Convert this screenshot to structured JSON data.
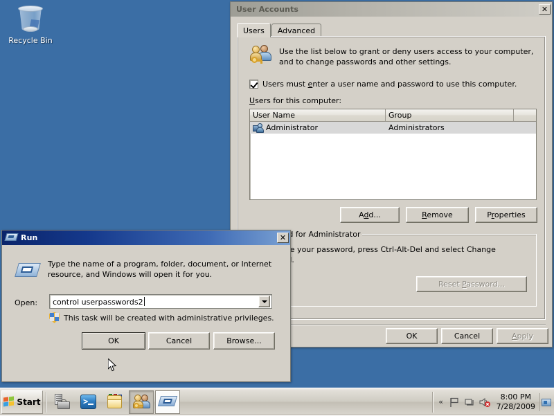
{
  "desktop": {
    "background_color": "#3b6ea5",
    "icons": [
      {
        "name": "recycle-bin",
        "label": "Recycle Bin"
      }
    ]
  },
  "user_accounts_window": {
    "title": "User Accounts",
    "close_label": "✕",
    "tabs": [
      {
        "label": "Users",
        "selected": true
      },
      {
        "label": "Advanced",
        "selected": false
      }
    ],
    "info_text": "Use the list below to grant or deny users access to your computer, and to change passwords and other settings.",
    "checkbox": {
      "label_before": "Users must ",
      "accel": "e",
      "label_after": "nter a user name and password to use this computer.",
      "checked": true
    },
    "list_label": "Users for this computer:",
    "columns": [
      "User Name",
      "Group"
    ],
    "rows": [
      {
        "user_name": "Administrator",
        "group": "Administrators",
        "selected": true
      }
    ],
    "list_buttons": [
      {
        "label_pre": "A",
        "accel": "d",
        "label_post": "d...",
        "name": "add-button",
        "disabled": false
      },
      {
        "label_pre": "",
        "accel": "R",
        "label_post": "emove",
        "name": "remove-button",
        "disabled": false
      },
      {
        "label_pre": "P",
        "accel": "r",
        "label_post": "operties",
        "name": "properties-button",
        "disabled": false
      }
    ],
    "group_box": {
      "legend": "Password for Administrator",
      "text": "To change your password, press Ctrl-Alt-Del and select Change Password.",
      "reset_button": {
        "label_pre": "Reset ",
        "accel": "P",
        "label_post": "assword...",
        "disabled": true
      }
    },
    "footer_buttons": [
      {
        "label": "OK",
        "name": "ok-button",
        "disabled": false
      },
      {
        "label": "Cancel",
        "name": "cancel-button",
        "disabled": false
      },
      {
        "label_pre": "",
        "accel": "A",
        "label_post": "pply",
        "name": "apply-button",
        "disabled": true
      }
    ]
  },
  "run_window": {
    "title": "Run",
    "close_label": "✕",
    "description": "Type the name of a program, folder, document, or Internet resource, and Windows will open it for you.",
    "open_label": "Open:",
    "open_value": "control userpasswords2",
    "open_placeholder": "",
    "uac_note": "This task will be created with administrative privileges.",
    "buttons": [
      {
        "label": "OK",
        "name": "run-ok-button",
        "default": true
      },
      {
        "label": "Cancel",
        "name": "run-cancel-button",
        "default": false
      },
      {
        "label": "Browse...",
        "name": "run-browse-button",
        "default": false
      }
    ]
  },
  "taskbar": {
    "start_label": "Start",
    "items": [
      {
        "name": "taskbar-server-manager",
        "state": "normal"
      },
      {
        "name": "taskbar-powershell",
        "state": "normal"
      },
      {
        "name": "taskbar-windows-explorer",
        "state": "normal"
      },
      {
        "name": "taskbar-user-accounts",
        "state": "pressed"
      },
      {
        "name": "taskbar-run",
        "state": "active"
      }
    ],
    "tray": {
      "show_hidden_icons": "«",
      "icons": [
        "flag-icon",
        "network-icon",
        "volume-muted-icon"
      ],
      "time": "8:00 PM",
      "date": "7/28/2009",
      "show_desktop": "show-desktop-button"
    }
  }
}
